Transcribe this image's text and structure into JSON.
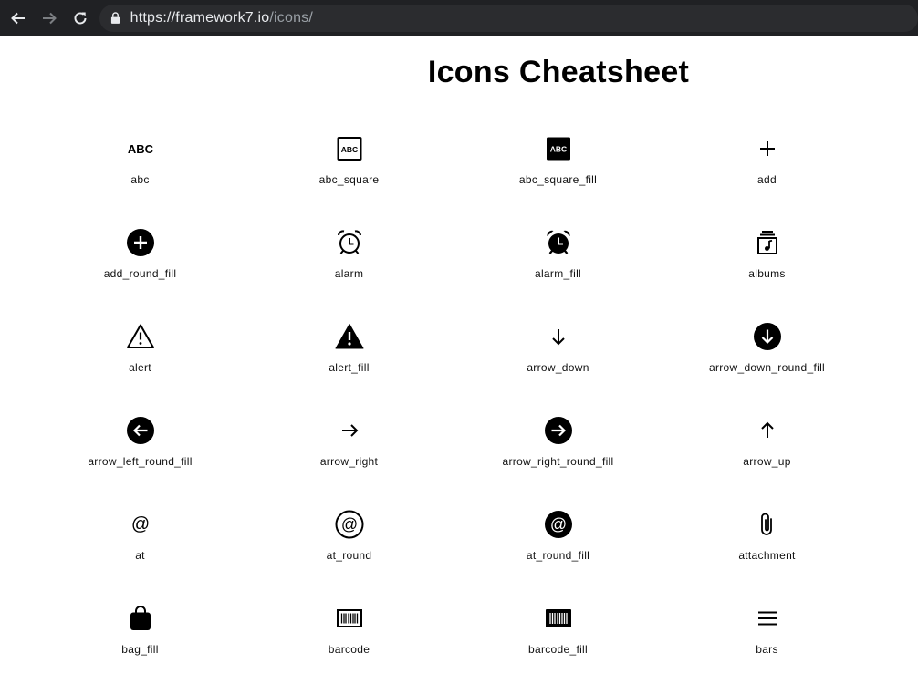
{
  "browser": {
    "url_host": "https://framework7.io",
    "url_path": "/icons/"
  },
  "page": {
    "title": "Icons Cheatsheet"
  },
  "icons": [
    {
      "label": "abc",
      "icon": "abc-icon"
    },
    {
      "label": "abc_square",
      "icon": "abc-square-icon"
    },
    {
      "label": "abc_square_fill",
      "icon": "abc-square-fill-icon"
    },
    {
      "label": "add",
      "icon": "add-icon"
    },
    {
      "label": "add_round_fill",
      "icon": "add-round-fill-icon"
    },
    {
      "label": "alarm",
      "icon": "alarm-icon"
    },
    {
      "label": "alarm_fill",
      "icon": "alarm-fill-icon"
    },
    {
      "label": "albums",
      "icon": "albums-icon"
    },
    {
      "label": "alert",
      "icon": "alert-icon"
    },
    {
      "label": "alert_fill",
      "icon": "alert-fill-icon"
    },
    {
      "label": "arrow_down",
      "icon": "arrow-down-icon"
    },
    {
      "label": "arrow_down_round_fill",
      "icon": "arrow-down-round-fill-icon"
    },
    {
      "label": "arrow_left_round_fill",
      "icon": "arrow-left-round-fill-icon"
    },
    {
      "label": "arrow_right",
      "icon": "arrow-right-icon"
    },
    {
      "label": "arrow_right_round_fill",
      "icon": "arrow-right-round-fill-icon"
    },
    {
      "label": "arrow_up",
      "icon": "arrow-up-icon"
    },
    {
      "label": "at",
      "icon": "at-icon"
    },
    {
      "label": "at_round",
      "icon": "at-round-icon"
    },
    {
      "label": "at_round_fill",
      "icon": "at-round-fill-icon"
    },
    {
      "label": "attachment",
      "icon": "attachment-icon"
    },
    {
      "label": "bag_fill",
      "icon": "bag-fill-icon"
    },
    {
      "label": "barcode",
      "icon": "barcode-icon"
    },
    {
      "label": "barcode_fill",
      "icon": "barcode-fill-icon"
    },
    {
      "label": "bars",
      "icon": "bars-icon"
    }
  ]
}
